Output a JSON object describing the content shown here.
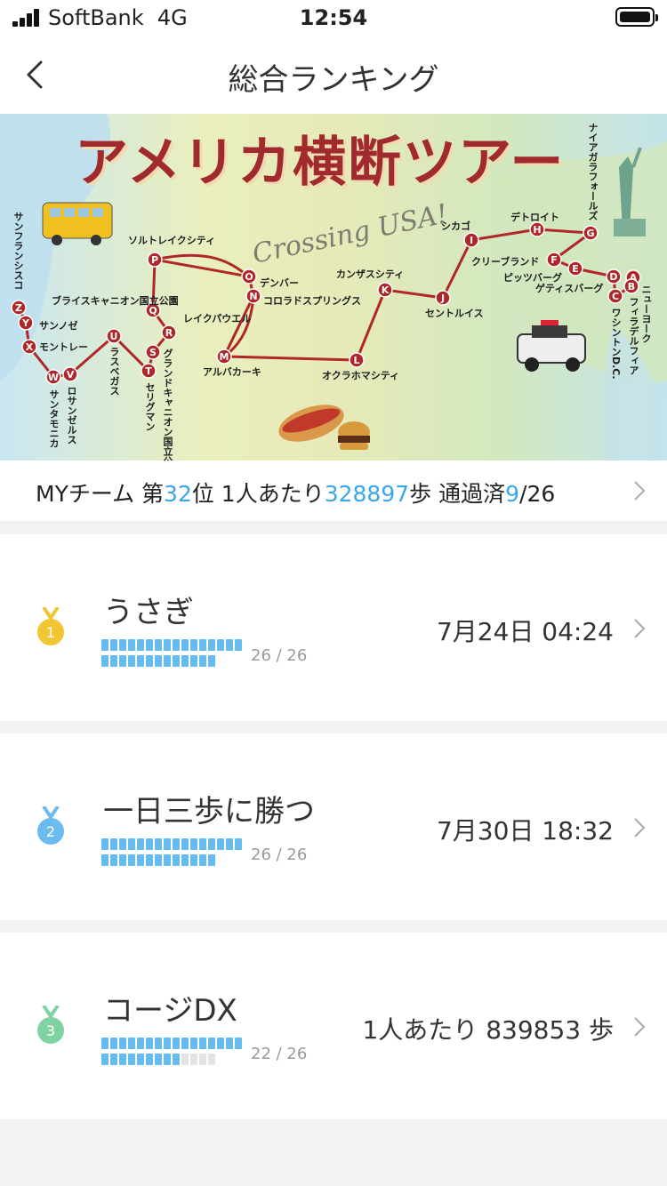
{
  "status_bar": {
    "carrier": "SoftBank",
    "network": "4G",
    "time": "12:54"
  },
  "nav": {
    "title": "総合ランキング",
    "back_icon": "chevron-left-icon"
  },
  "banner": {
    "title": "アメリカ横断ツアー",
    "subtitle": "Crossing USA!",
    "stops": [
      {
        "letter": "A",
        "name": "ニューヨーク"
      },
      {
        "letter": "B",
        "name": "フィラデルフィア"
      },
      {
        "letter": "C",
        "name": "ワシントンD.C."
      },
      {
        "letter": "D",
        "name": "ゲティスバーグ"
      },
      {
        "letter": "E",
        "name": "ピッツバーグ"
      },
      {
        "letter": "F",
        "name": "クリーブランド"
      },
      {
        "letter": "G",
        "name": "ナイアガラフォールズ"
      },
      {
        "letter": "H",
        "name": "デトロイト"
      },
      {
        "letter": "I",
        "name": "シカゴ"
      },
      {
        "letter": "J",
        "name": "セントルイス"
      },
      {
        "letter": "K",
        "name": "カンザスシティ"
      },
      {
        "letter": "L",
        "name": "オクラホマシティ"
      },
      {
        "letter": "M",
        "name": "アルバカーキ"
      },
      {
        "letter": "N",
        "name": "コロラドスプリングス"
      },
      {
        "letter": "O",
        "name": "デンバー"
      },
      {
        "letter": "P",
        "name": "ソルトレイクシティ"
      },
      {
        "letter": "Q",
        "name": "ブライスキャニオン国立公園"
      },
      {
        "letter": "R",
        "name": "レイクパウエル"
      },
      {
        "letter": "S",
        "name": "グランドキャニオン国立公園"
      },
      {
        "letter": "T",
        "name": "セリグマン"
      },
      {
        "letter": "U",
        "name": "ラスベガス"
      },
      {
        "letter": "V",
        "name": "ロサンゼルス"
      },
      {
        "letter": "W",
        "name": "サンタモニカ"
      },
      {
        "letter": "X",
        "name": "モントレー"
      },
      {
        "letter": "Y",
        "name": "サンノゼ"
      },
      {
        "letter": "Z",
        "name": "サンフランシスコ"
      }
    ]
  },
  "summary": {
    "prefix": "MYチーム 第",
    "rank": "32",
    "rank_suffix": "位 1人あたり",
    "steps": "328897",
    "steps_suffix": "歩 通過済",
    "passed": "9",
    "total": "/26"
  },
  "ranking": [
    {
      "rank": "1",
      "team": "うさぎ",
      "completed": 26,
      "total": 26,
      "progress_text": "26 / 26",
      "value": "7月24日 04:24",
      "medal_color": "#f2c533"
    },
    {
      "rank": "2",
      "team": "一日三歩に勝つ",
      "completed": 26,
      "total": 26,
      "progress_text": "26 / 26",
      "value": "7月30日 18:32",
      "medal_color": "#6bbbee"
    },
    {
      "rank": "3",
      "team": "コージDX",
      "completed": 22,
      "total": 26,
      "progress_text": "22 / 26",
      "value": "1人あたり 839853 歩",
      "medal_color": "#7fd3a2"
    }
  ],
  "colors": {
    "accent": "#3aa6ec",
    "route": "#b0272a",
    "progress": "#66bcef"
  }
}
